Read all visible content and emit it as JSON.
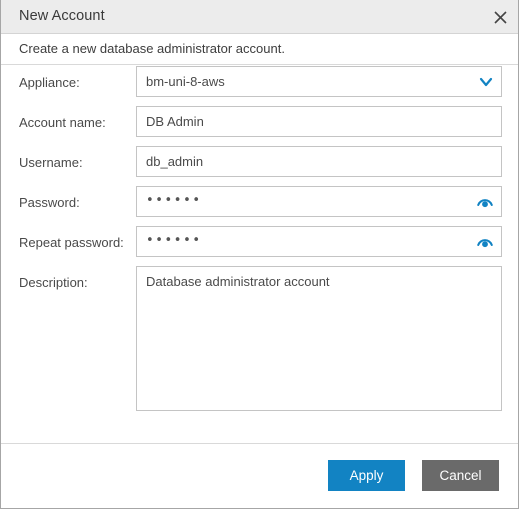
{
  "window": {
    "title": "New Account",
    "close_icon": "close-icon",
    "subtitle": "Create a new database administrator account."
  },
  "form": {
    "fields": [
      {
        "label": "Appliance:",
        "type": "select",
        "value": "bm-uni-8-aws",
        "icon": "chevron-down-icon",
        "name": "appliance"
      },
      {
        "label": "Account name:",
        "type": "text",
        "value": "DB Admin",
        "name": "account-name"
      },
      {
        "label": "Username:",
        "type": "text",
        "value": "db_admin",
        "name": "username"
      },
      {
        "label": "Password:",
        "type": "password",
        "value": "••••••",
        "icon": "reveal-password-icon",
        "name": "password"
      },
      {
        "label": "Repeat password:",
        "type": "password",
        "value": "••••••",
        "icon": "reveal-password-icon",
        "name": "repeat-password"
      }
    ],
    "description": {
      "label": "Description:",
      "value": "Database administrator account"
    }
  },
  "footer": {
    "apply_label": "Apply",
    "cancel_label": "Cancel"
  },
  "colors": {
    "accent": "#1283c3",
    "cancel": "#6a6a6a",
    "titlebar": "#ececec",
    "border": "#c4c4c4"
  }
}
